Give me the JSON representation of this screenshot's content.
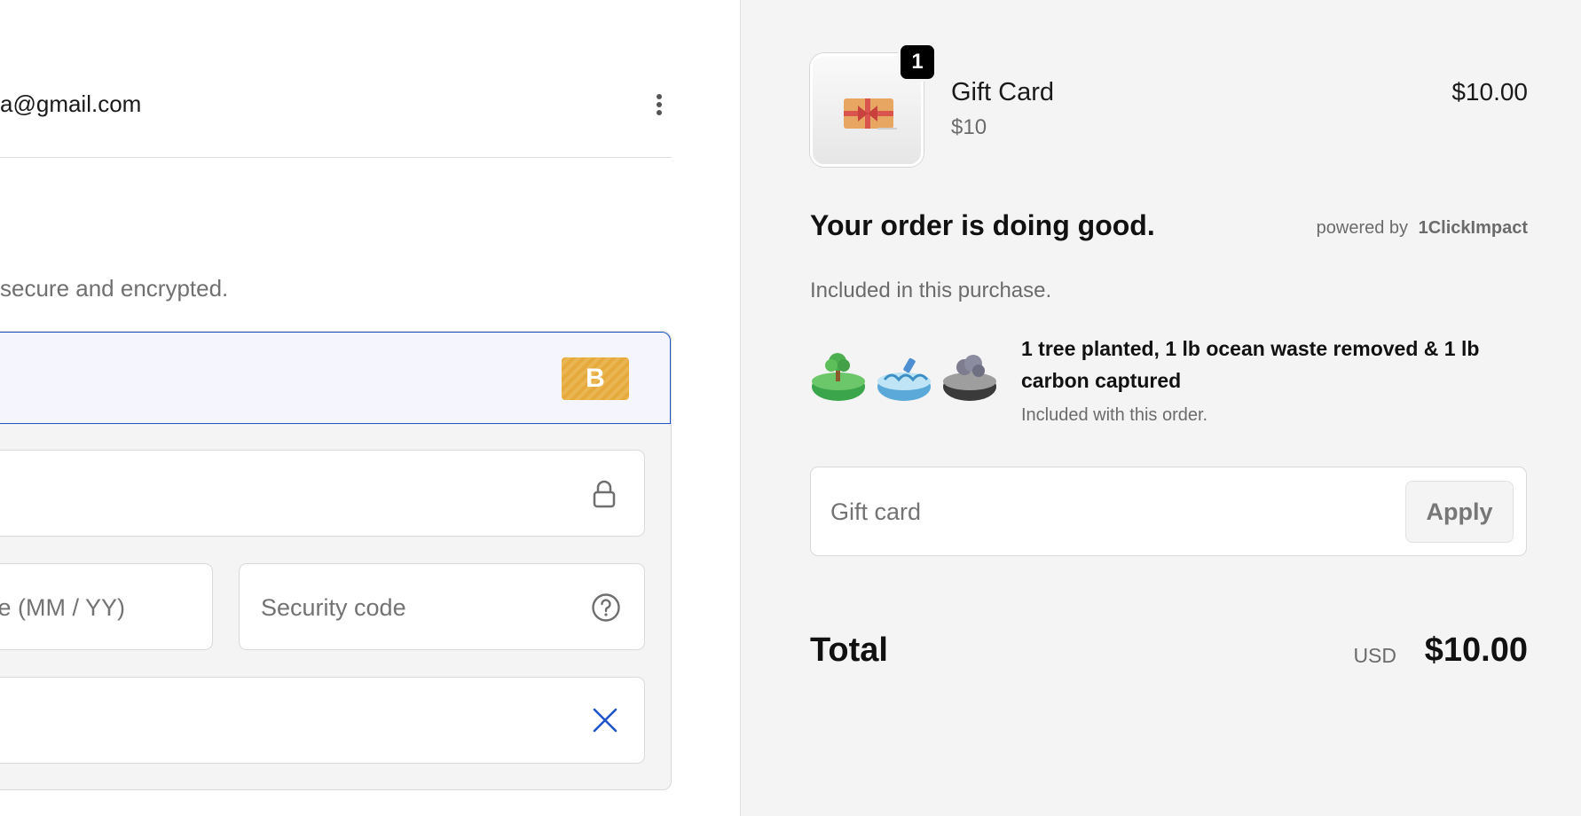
{
  "account": {
    "email": "a@gmail.com",
    "menu_icon": "kebab-menu-icon"
  },
  "payment": {
    "secure_note": "secure and encrypted.",
    "card_brand_letter": "B",
    "card_brand_color": "#e6a93b",
    "expiry_placeholder": "e (MM / YY)",
    "security_placeholder": "Security code",
    "active_border_color": "#1f55c7"
  },
  "summary": {
    "product": {
      "name": "Gift Card",
      "variant": "$10",
      "price": "$10.00",
      "quantity": "1",
      "image_icon": "gift-card-icon"
    },
    "impact": {
      "title": "Your order is doing good.",
      "powered_by_prefix": "powered by",
      "powered_by_brand": "1ClickImpact",
      "subtitle": "Included in this purchase.",
      "description": "1 tree planted, 1 lb ocean waste removed & 1 lb carbon captured",
      "note": "Included with this order.",
      "icons": [
        "tree-icon",
        "ocean-icon",
        "carbon-icon"
      ]
    },
    "gift_card": {
      "placeholder": "Gift card",
      "apply_label": "Apply"
    },
    "total": {
      "label": "Total",
      "currency": "USD",
      "amount": "$10.00"
    }
  }
}
